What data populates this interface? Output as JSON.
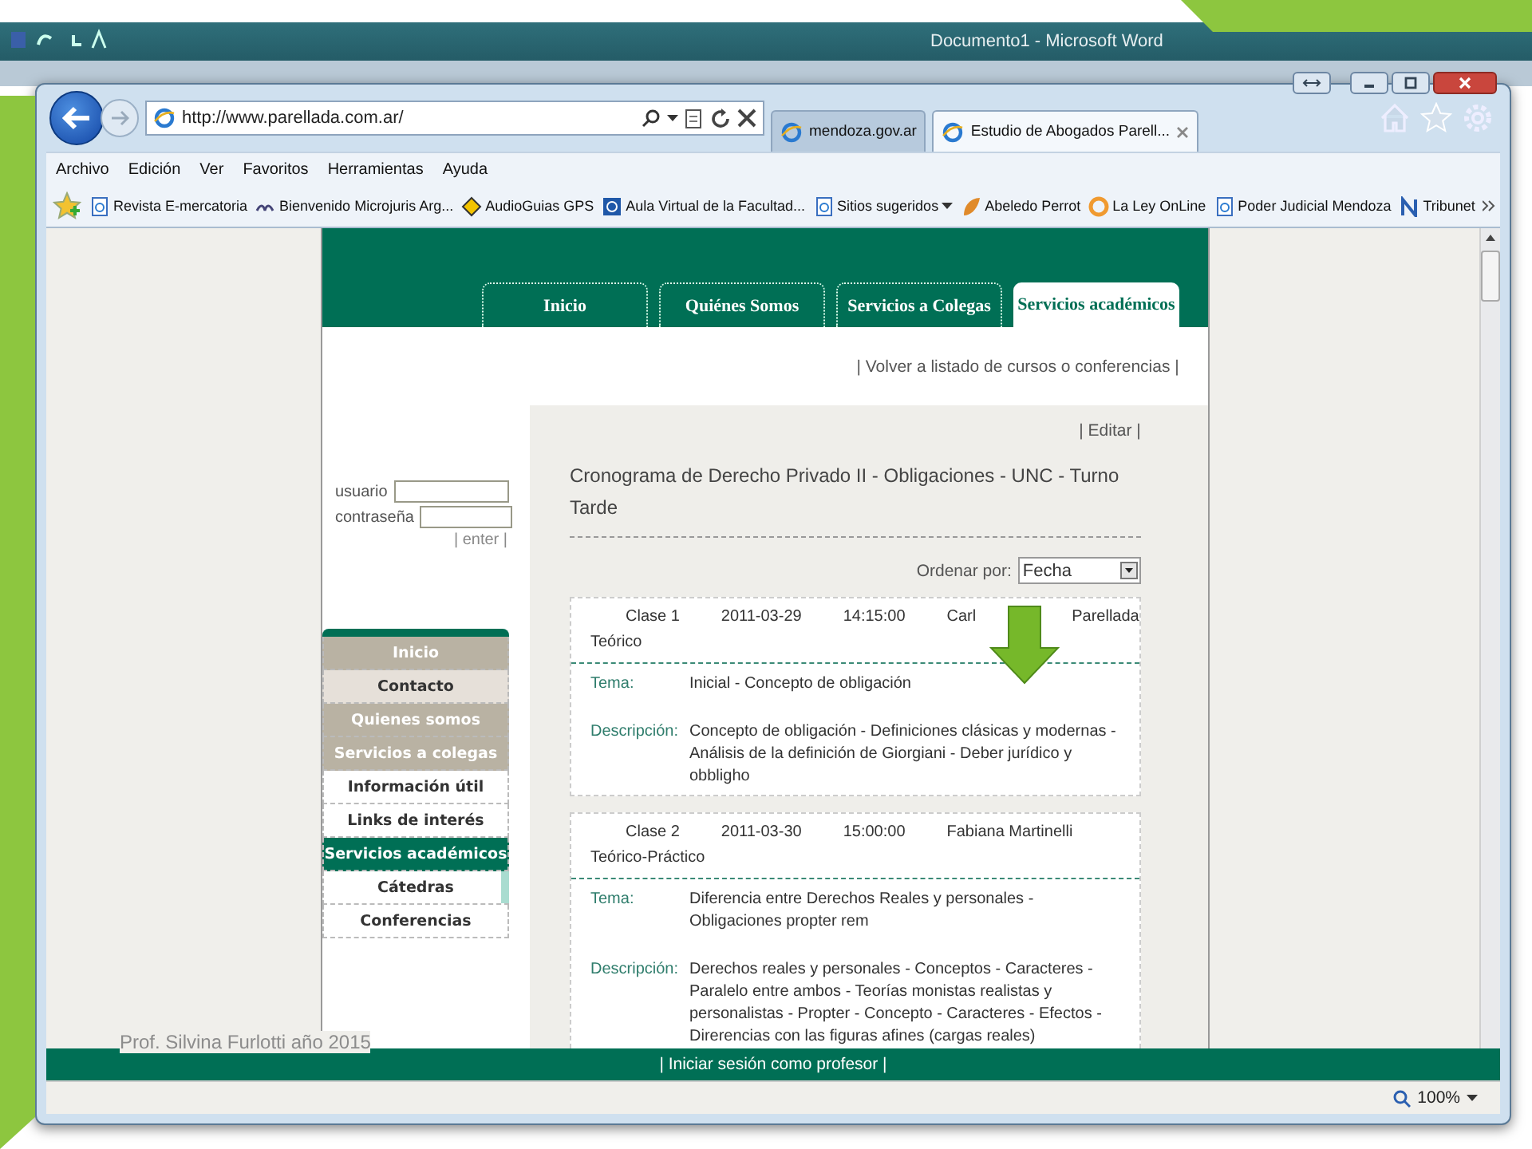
{
  "word_window": {
    "title": "Documento1 - Microsoft Word"
  },
  "browser": {
    "address": "http://www.parellada.com.ar/",
    "tabs": [
      {
        "label": "mendoza.gov.ar",
        "selected": false
      },
      {
        "label": "Estudio de Abogados Parell...",
        "selected": true
      }
    ],
    "menu": [
      "Archivo",
      "Edición",
      "Ver",
      "Favoritos",
      "Herramientas",
      "Ayuda"
    ],
    "favorites": [
      {
        "label": "Revista E-mercatoria",
        "kind": "page"
      },
      {
        "label": "Bienvenido Microjuris Arg...",
        "kind": "mj"
      },
      {
        "label": "AudioGuias GPS",
        "kind": "diamond"
      },
      {
        "label": "Aula Virtual de la Facultad...",
        "kind": "square"
      },
      {
        "label": "Sitios sugeridos",
        "kind": "dropdown"
      },
      {
        "label": "Abeledo Perrot",
        "kind": "leaf"
      },
      {
        "label": "La Ley OnLine",
        "kind": "ring"
      },
      {
        "label": "Poder Judicial Mendoza",
        "kind": "page"
      },
      {
        "label": "Tribunet",
        "kind": "n"
      }
    ],
    "zoom": "100%"
  },
  "site": {
    "nav_tabs": [
      {
        "label": "Inicio",
        "selected": false
      },
      {
        "label": "Quiénes Somos",
        "selected": false
      },
      {
        "label": "Servicios a Colegas",
        "selected": false
      },
      {
        "label": "Servicios académicos",
        "selected": true
      }
    ],
    "back_link": "|  Volver a listado de cursos o conferencias  |",
    "login": {
      "user_label": "usuario",
      "password_label": "contraseña",
      "enter": "| enter |"
    },
    "side_menu": [
      {
        "label": "Inicio",
        "kind": "dark",
        "selected": false
      },
      {
        "label": "Contacto",
        "kind": "light",
        "selected": false
      },
      {
        "label": "Quienes somos",
        "kind": "dark",
        "selected": false
      },
      {
        "label": "Servicios a colegas",
        "kind": "dark",
        "selected": false
      },
      {
        "label": "Información útil",
        "kind": "plain",
        "selected": false
      },
      {
        "label": "Links de interés",
        "kind": "plain",
        "selected": false
      },
      {
        "label": "Servicios académicos",
        "kind": "plain",
        "selected": true
      },
      {
        "label": "Cátedras",
        "kind": "sub",
        "selected": false
      },
      {
        "label": "Conferencias",
        "kind": "sub",
        "selected": false
      }
    ],
    "edit_link": "| Editar |",
    "title": "Cronograma de Derecho Privado II - Obligaciones - UNC - Turno Tarde",
    "sort": {
      "label": "Ordenar por:",
      "value": "Fecha"
    },
    "classes": [
      {
        "number": "Clase 1",
        "date": "2011-03-29",
        "time": "14:15:00",
        "teacher": [
          "Carl",
          "Parellada"
        ],
        "type": "Teórico",
        "topic_label": "Tema:",
        "topic": "Inicial - Concepto de obligación",
        "description_label": "Descripción:",
        "description": "Concepto de obligación - Definiciones clásicas y modernas - Análisis de la definición de Giorgiani - Deber jurídico y obbligho"
      },
      {
        "number": "Clase 2",
        "date": "2011-03-30",
        "time": "15:00:00",
        "teacher": [
          "Fabiana Martinelli"
        ],
        "type": "Teórico-Práctico",
        "topic_label": "Tema:",
        "topic": "Diferencia entre Derechos Reales y personales - Obligaciones propter rem",
        "description_label": "Descripción:",
        "description": "Derechos reales y personales - Conceptos - Caracteres - Paralelo entre ambos - Teorías monistas realistas y personalistas - Propter - Concepto - Caracteres - Efectos - Direrencias con las figuras afines (cargas reales)"
      }
    ],
    "footer_link": "|    Iniciar sesión como profesor    |"
  },
  "slide": {
    "footer": "Prof. Silvina Furlotti año 2015"
  }
}
